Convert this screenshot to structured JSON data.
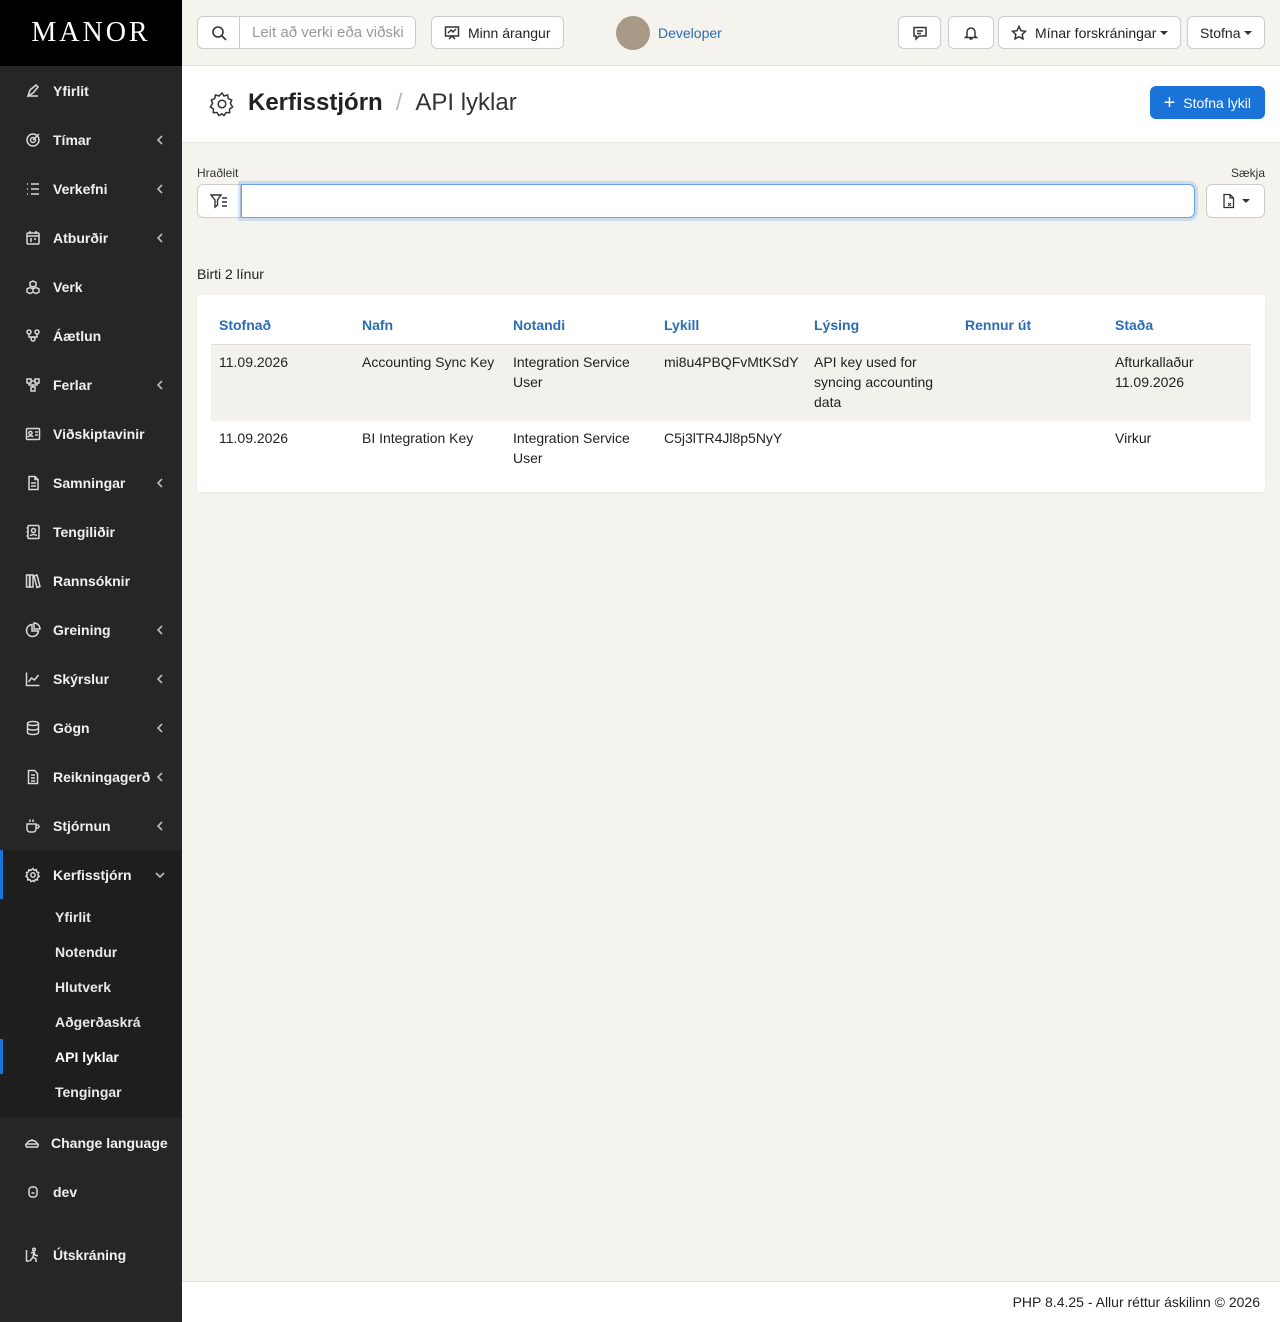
{
  "brand": "MANOR",
  "sidebar": {
    "items": [
      {
        "label": "Yfirlit",
        "icon": "pen-icon",
        "chevron": false
      },
      {
        "label": "Tímar",
        "icon": "target-icon",
        "chevron": true
      },
      {
        "label": "Verkefni",
        "icon": "list-icon",
        "chevron": true
      },
      {
        "label": "Atburðir",
        "icon": "calendar-icon",
        "chevron": true
      },
      {
        "label": "Verk",
        "icon": "cubes-icon",
        "chevron": false
      },
      {
        "label": "Áætlun",
        "icon": "people-icon",
        "chevron": false
      },
      {
        "label": "Ferlar",
        "icon": "flow-icon",
        "chevron": true
      },
      {
        "label": "Viðskiptavinir",
        "icon": "id-card-icon",
        "chevron": false
      },
      {
        "label": "Samningar",
        "icon": "document-icon",
        "chevron": true
      },
      {
        "label": "Tengiliðir",
        "icon": "contact-icon",
        "chevron": false
      },
      {
        "label": "Rannsóknir",
        "icon": "books-icon",
        "chevron": false
      },
      {
        "label": "Greining",
        "icon": "pie-icon",
        "chevron": true
      },
      {
        "label": "Skýrslur",
        "icon": "line-chart-icon",
        "chevron": true
      },
      {
        "label": "Gögn",
        "icon": "database-icon",
        "chevron": true
      },
      {
        "label": "Reikningagerð",
        "icon": "invoice-icon",
        "chevron": true
      },
      {
        "label": "Stjórnun",
        "icon": "coffee-icon",
        "chevron": true
      },
      {
        "label": "Kerfisstjórn",
        "icon": "gear-icon",
        "chevron": true
      }
    ],
    "subitems": [
      {
        "label": "Yfirlit"
      },
      {
        "label": "Notendur"
      },
      {
        "label": "Hlutverk"
      },
      {
        "label": "Aðgerðaskrá"
      },
      {
        "label": "API lyklar"
      },
      {
        "label": "Tengingar"
      }
    ],
    "bottom": [
      {
        "label": "Change language",
        "icon": "language-icon"
      },
      {
        "label": "dev",
        "icon": "lock-icon"
      },
      {
        "label": "Útskráning",
        "icon": "exit-icon"
      }
    ]
  },
  "topbar": {
    "search_placeholder": "Leit að verki eða viðskiptavini",
    "my_progress": "Minn árangur",
    "user_name": "Developer",
    "favorites": "Mínar forskráningar",
    "create": "Stofna"
  },
  "header": {
    "section": "Kerfisstjórn",
    "separator": "/",
    "current": "API lyklar",
    "create_button": "Stofna lykil"
  },
  "filter": {
    "label": "Hraðleit",
    "value": "",
    "export_label": "Sækja"
  },
  "row_count": "Birti 2 línur",
  "table": {
    "columns": [
      "Stofnað",
      "Nafn",
      "Notandi",
      "Lykill",
      "Lýsing",
      "Rennur út",
      "Staða"
    ],
    "rows": [
      [
        "11.09.2026",
        "Accounting Sync Key",
        "Integration Service User",
        "mi8u4PBQFvMtKSdY",
        "API key used for syncing accounting data",
        "",
        "Afturkallaður 11.09.2026"
      ],
      [
        "11.09.2026",
        "BI Integration Key",
        "Integration Service User",
        "C5j3lTR4Jl8p5NyY",
        "",
        "",
        "Virkur"
      ]
    ]
  },
  "footer": "PHP 8.4.25 - Allur réttur áskilinn © 2026",
  "colors": {
    "accent": "#1a73d9",
    "sidebar": "#262626",
    "background": "#f4f3ee",
    "link": "#2a6db3"
  }
}
